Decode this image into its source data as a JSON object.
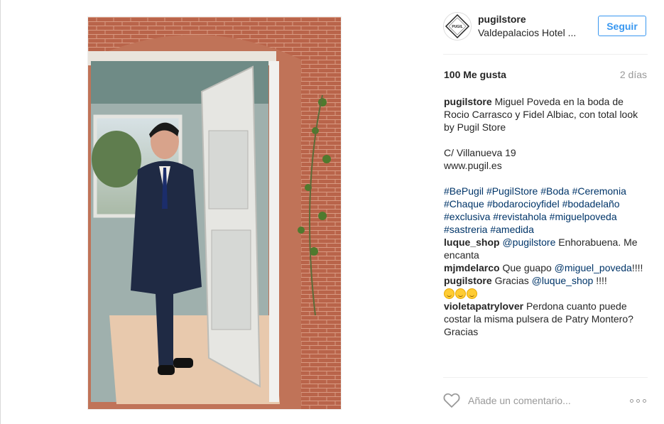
{
  "post": {
    "username": "pugilstore",
    "location": "Valdepalacios Hotel ...",
    "follow_label": "Seguir",
    "likes": "100 Me gusta",
    "time_ago": "2 días",
    "avatar_text": "PUGIL"
  },
  "caption": {
    "username": "pugilstore",
    "text": "Miguel Poveda en la boda de Rocio Carrasco y Fidel Albiac, con total look by Pugil Store",
    "address": "C/ Villanueva 19",
    "website": "www.pugil.es",
    "hashtags": [
      "#BePugil",
      "#PugilStore",
      "#Boda",
      "#Ceremonia",
      "#Chaque",
      "#bodarocioyfidel",
      "#bodadelaño",
      "#exclusiva",
      "#revistahola",
      "#miguelpoveda",
      "#sastreria",
      "#amedida"
    ]
  },
  "comments": [
    {
      "username": "luque_shop",
      "mention": "@pugilstore",
      "text": "Enhorabuena. Me encanta"
    },
    {
      "username": "mjmdelarco",
      "text1": "Que guapo",
      "mention": "@miguel_poveda",
      "text2": "!!!!"
    },
    {
      "username": "pugilstore",
      "text1": "Gracias",
      "mention": "@luque_shop",
      "text2": "!!!!"
    },
    {
      "username": "violetapatrylover",
      "text": "Perdona cuanto puede costar la misma pulsera de Patry Montero? Gracias"
    }
  ],
  "add_comment": {
    "placeholder": "Añade un comentario..."
  },
  "icons": {
    "like": "heart-icon",
    "more": "more-options-icon"
  },
  "colors": {
    "link": "#003569",
    "accent": "#3897f0",
    "muted": "#999999"
  }
}
